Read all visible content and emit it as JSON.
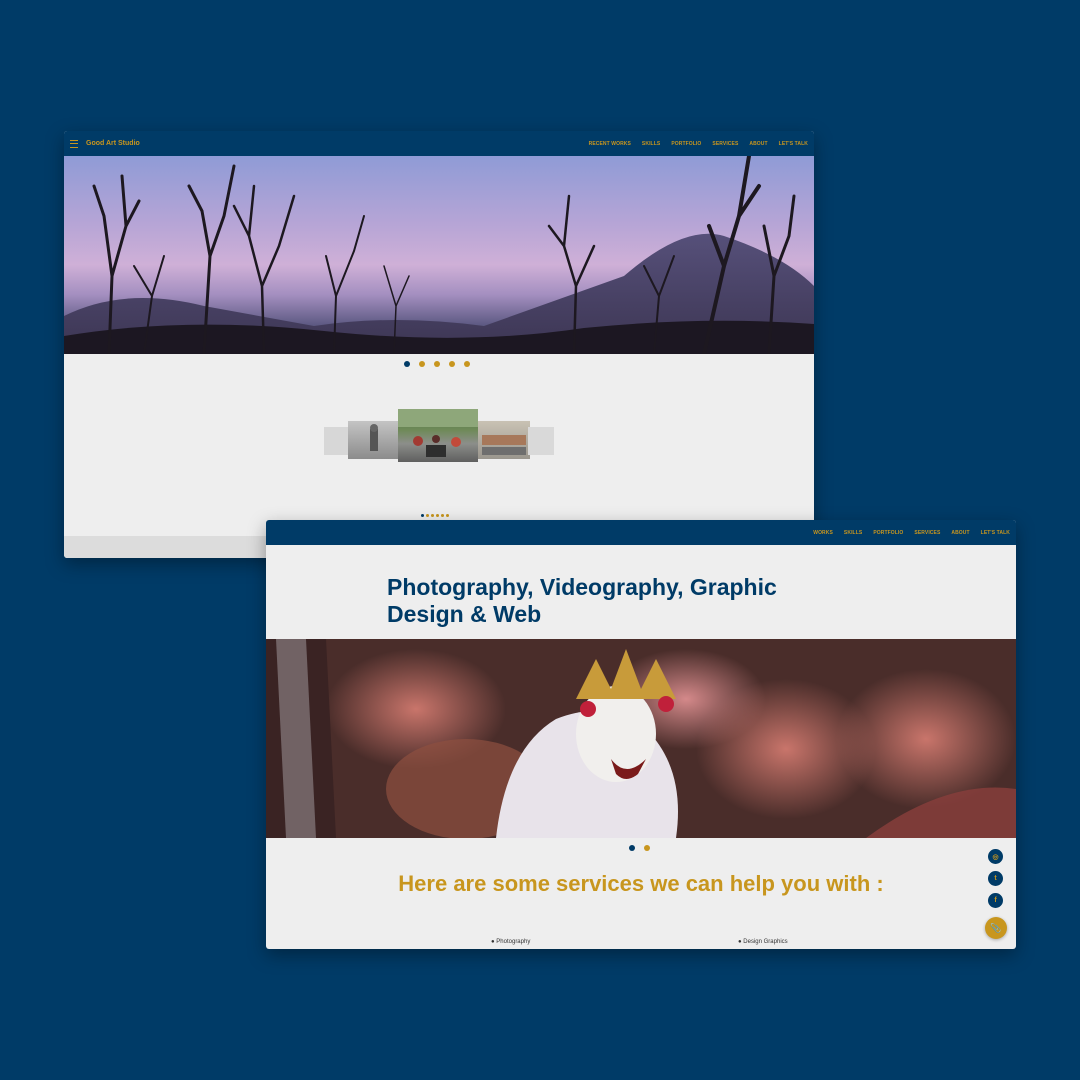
{
  "colors": {
    "background": "#003b67",
    "accent": "#c8961e",
    "panel": "#eeeeee"
  },
  "window1": {
    "brand": "Good Art Studio",
    "nav": [
      "RECENT WORKS",
      "SKILLS",
      "PORTFOLIO",
      "SERVICES",
      "ABOUT",
      "LET'S TALK"
    ],
    "hero_slide": {
      "count": 5,
      "active": 1
    },
    "gallery_slide": {
      "count": 6,
      "active": 1
    },
    "fab_icon": "paperclip-icon"
  },
  "window2": {
    "nav": [
      "WORKS",
      "SKILLS",
      "PORTFOLIO",
      "SERVICES",
      "ABOUT",
      "LET'S TALK"
    ],
    "title": "Photography, Videography, Graphic Design & Web",
    "hero_slide": {
      "count": 2,
      "active": 1
    },
    "services_heading": "Here are some services we can help you with :",
    "services": [
      "Photography",
      "Design Graphics"
    ],
    "social_icons": [
      "instagram-icon",
      "twitter-icon",
      "facebook-icon"
    ],
    "fab_icon": "paperclip-icon"
  }
}
